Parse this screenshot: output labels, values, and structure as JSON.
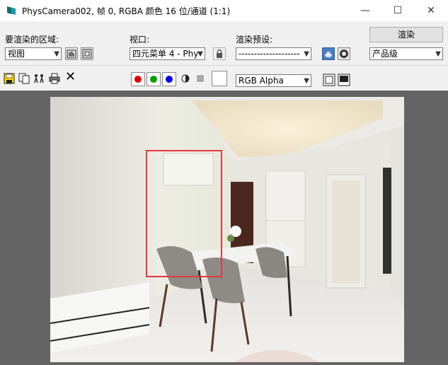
{
  "window": {
    "title": "PhysCamera002, 帧 0, RGBA 颜色 16 位/通道 (1:1)",
    "minimize_glyph": "—",
    "maximize_glyph": "☐",
    "close_glyph": "✕"
  },
  "panel": {
    "area_label": "要渲染的区域:",
    "area_value": "视图",
    "viewport_label": "视口:",
    "viewport_value": "四元菜单 4 - Phy",
    "preset_label": "渲染预设:",
    "preset_value": "--------------------",
    "render_button": "渲染",
    "quality_value": "产品级"
  },
  "toolbar": {
    "channel_value": "RGB Alpha",
    "clear_glyph": "✕",
    "red_color": "#e00000",
    "green_color": "#00a000",
    "blue_color": "#0000e0"
  },
  "colors": {
    "highlight": "#e8363d",
    "viewport_bg": "#646464"
  }
}
